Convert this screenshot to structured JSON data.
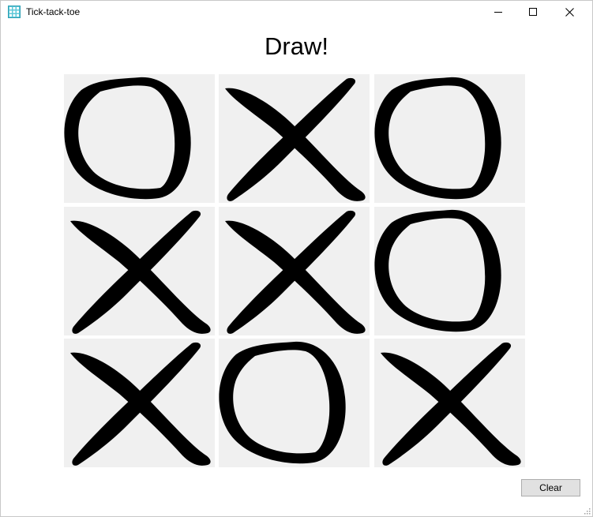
{
  "window": {
    "title": "Tick-tack-toe",
    "icon": "grid-app-icon"
  },
  "status": "Draw!",
  "board": {
    "cells": [
      "O",
      "X",
      "O",
      "X",
      "X",
      "O",
      "X",
      "O",
      "X"
    ]
  },
  "controls": {
    "clear_label": "Clear"
  }
}
